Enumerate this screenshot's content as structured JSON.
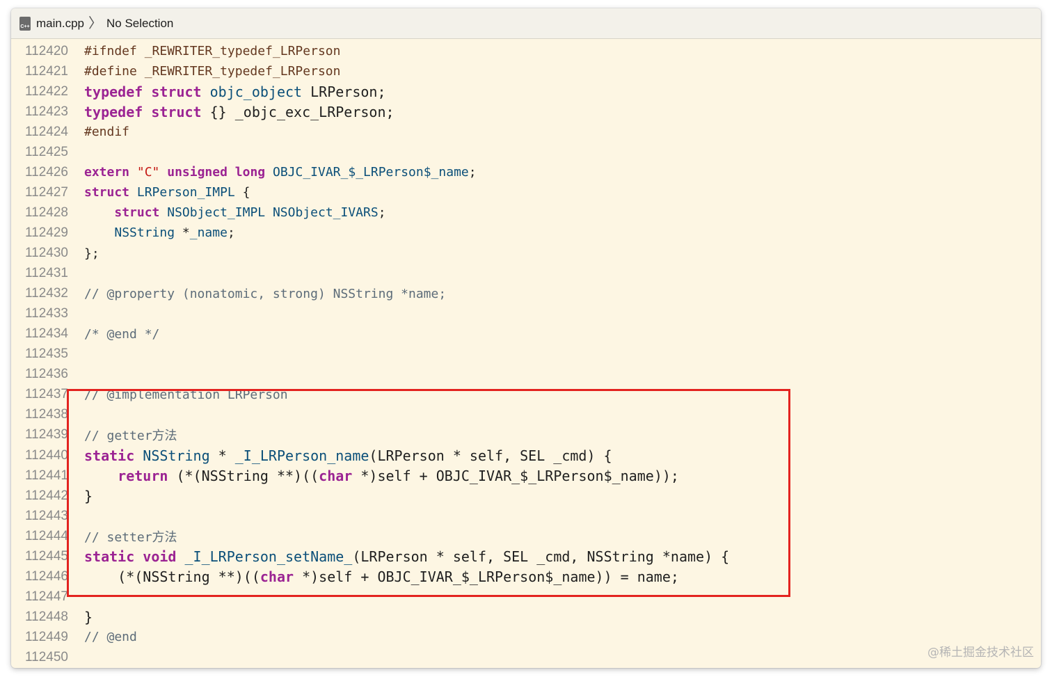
{
  "jumpbar": {
    "file_icon_text": "C++",
    "file_name": "main.cpp",
    "separator": "〉",
    "selection": "No Selection"
  },
  "watermark": "@稀土掘金技术社区",
  "lines": [
    {
      "n": "112420",
      "big": false,
      "tokens": [
        {
          "t": "#ifndef _REWRITER_typedef_LRPerson",
          "c": "pp"
        }
      ]
    },
    {
      "n": "112421",
      "big": false,
      "tokens": [
        {
          "t": "#define _REWRITER_typedef_LRPerson",
          "c": "pp"
        }
      ]
    },
    {
      "n": "112422",
      "big": true,
      "tokens": [
        {
          "t": "typedef",
          "c": "kw"
        },
        {
          "t": " "
        },
        {
          "t": "struct",
          "c": "kw"
        },
        {
          "t": " "
        },
        {
          "t": "objc_object",
          "c": "ty"
        },
        {
          "t": " LRPerson;"
        }
      ]
    },
    {
      "n": "112423",
      "big": true,
      "tokens": [
        {
          "t": "typedef",
          "c": "kw"
        },
        {
          "t": " "
        },
        {
          "t": "struct",
          "c": "kw"
        },
        {
          "t": " {} _objc_exc_LRPerson;"
        }
      ]
    },
    {
      "n": "112424",
      "big": false,
      "tokens": [
        {
          "t": "#endif",
          "c": "pp"
        }
      ]
    },
    {
      "n": "112425",
      "big": false,
      "tokens": []
    },
    {
      "n": "112426",
      "big": false,
      "tokens": [
        {
          "t": "extern",
          "c": "kw"
        },
        {
          "t": " "
        },
        {
          "t": "\"C\"",
          "c": "str"
        },
        {
          "t": " "
        },
        {
          "t": "unsigned",
          "c": "kw"
        },
        {
          "t": " "
        },
        {
          "t": "long",
          "c": "kw"
        },
        {
          "t": " "
        },
        {
          "t": "OBJC_IVAR_$_LRPerson$_name",
          "c": "ty"
        },
        {
          "t": ";"
        }
      ]
    },
    {
      "n": "112427",
      "big": false,
      "tokens": [
        {
          "t": "struct",
          "c": "kw"
        },
        {
          "t": " "
        },
        {
          "t": "LRPerson_IMPL",
          "c": "ty"
        },
        {
          "t": " {"
        }
      ]
    },
    {
      "n": "112428",
      "big": false,
      "tokens": [
        {
          "t": "    "
        },
        {
          "t": "struct",
          "c": "kw"
        },
        {
          "t": " "
        },
        {
          "t": "NSObject_IMPL",
          "c": "ty"
        },
        {
          "t": " "
        },
        {
          "t": "NSObject_IVARS",
          "c": "ty"
        },
        {
          "t": ";"
        }
      ]
    },
    {
      "n": "112429",
      "big": false,
      "tokens": [
        {
          "t": "    "
        },
        {
          "t": "NSString",
          "c": "ty"
        },
        {
          "t": " *"
        },
        {
          "t": "_name",
          "c": "ty"
        },
        {
          "t": ";"
        }
      ]
    },
    {
      "n": "112430",
      "big": false,
      "tokens": [
        {
          "t": "};"
        }
      ]
    },
    {
      "n": "112431",
      "big": false,
      "tokens": []
    },
    {
      "n": "112432",
      "big": false,
      "tokens": [
        {
          "t": "// @property (nonatomic, strong) NSString *name;",
          "c": "cm"
        }
      ]
    },
    {
      "n": "112433",
      "big": false,
      "tokens": []
    },
    {
      "n": "112434",
      "big": false,
      "tokens": [
        {
          "t": "/* @end */",
          "c": "cm"
        }
      ]
    },
    {
      "n": "112435",
      "big": false,
      "tokens": []
    },
    {
      "n": "112436",
      "big": false,
      "tokens": []
    },
    {
      "n": "112437",
      "big": false,
      "tokens": [
        {
          "t": "// @implementation LRPerson",
          "c": "cm"
        }
      ]
    },
    {
      "n": "112438",
      "big": false,
      "tokens": []
    },
    {
      "n": "112439",
      "big": false,
      "tokens": [
        {
          "t": "// getter方法",
          "c": "cm"
        }
      ]
    },
    {
      "n": "112440",
      "big": true,
      "tokens": [
        {
          "t": "static",
          "c": "kw"
        },
        {
          "t": " "
        },
        {
          "t": "NSString",
          "c": "ty"
        },
        {
          "t": " * "
        },
        {
          "t": "_I_LRPerson_name",
          "c": "ty"
        },
        {
          "t": "(LRPerson * self, SEL _cmd) {"
        }
      ]
    },
    {
      "n": "112441",
      "big": true,
      "tokens": [
        {
          "t": "    "
        },
        {
          "t": "return",
          "c": "kw"
        },
        {
          "t": " (*(NSString **)(("
        },
        {
          "t": "char",
          "c": "kw"
        },
        {
          "t": " *)self + OBJC_IVAR_$_LRPerson$_name));"
        }
      ]
    },
    {
      "n": "112442",
      "big": true,
      "tokens": [
        {
          "t": "}"
        }
      ]
    },
    {
      "n": "112443",
      "big": false,
      "tokens": []
    },
    {
      "n": "112444",
      "big": false,
      "tokens": [
        {
          "t": "// setter方法",
          "c": "cm"
        }
      ]
    },
    {
      "n": "112445",
      "big": true,
      "tokens": [
        {
          "t": "static",
          "c": "kw"
        },
        {
          "t": " "
        },
        {
          "t": "void",
          "c": "kw"
        },
        {
          "t": " "
        },
        {
          "t": "_I_LRPerson_setName_",
          "c": "ty"
        },
        {
          "t": "(LRPerson * self, SEL _cmd, NSString *name) {"
        }
      ]
    },
    {
      "n": "112446",
      "big": true,
      "tokens": [
        {
          "t": "    (*(NSString **)(("
        },
        {
          "t": "char",
          "c": "kw"
        },
        {
          "t": " *)self + OBJC_IVAR_$_LRPerson$_name)) = name;"
        }
      ]
    },
    {
      "n": "112447",
      "big": false,
      "tokens": []
    },
    {
      "n": "112448",
      "big": true,
      "tokens": [
        {
          "t": "}"
        }
      ]
    },
    {
      "n": "112449",
      "big": false,
      "tokens": [
        {
          "t": "// @end",
          "c": "cm"
        }
      ]
    },
    {
      "n": "112450",
      "big": false,
      "tokens": []
    }
  ]
}
